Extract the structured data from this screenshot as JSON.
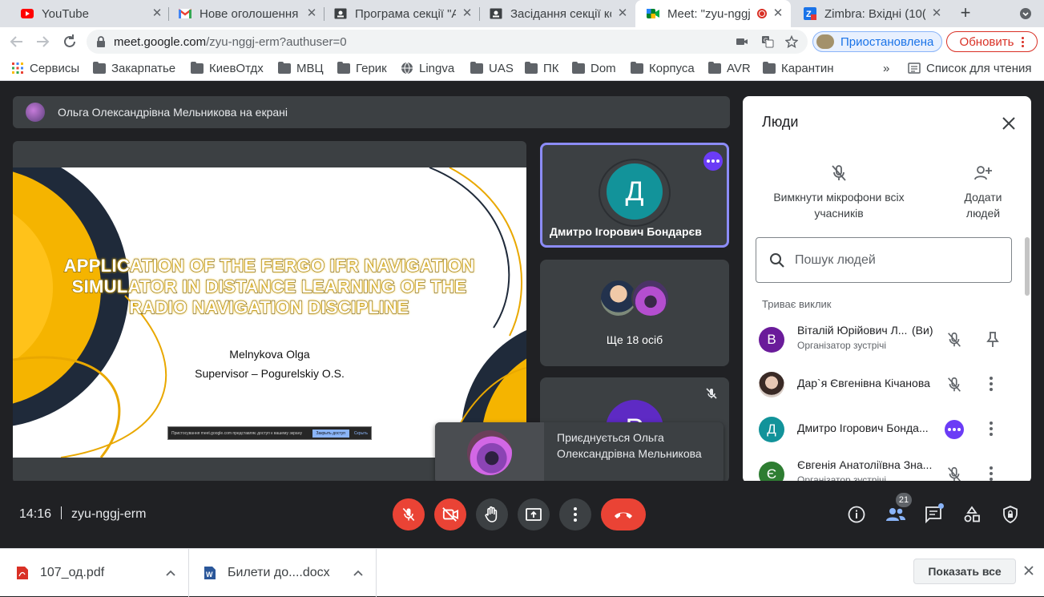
{
  "browser": {
    "tabs": [
      {
        "title": "YouTube",
        "icon": "youtube-icon"
      },
      {
        "title": "Нове оголошення",
        "icon": "gmail-icon"
      },
      {
        "title": "Програма секції \"А",
        "icon": "document-icon"
      },
      {
        "title": "Засідання секції ко",
        "icon": "document-icon"
      },
      {
        "title": "Meet: \"zyu-nggj",
        "icon": "meet-icon",
        "active": true
      },
      {
        "title": "Zimbra: Вхідні (10(",
        "icon": "zimbra-icon"
      }
    ],
    "url_host": "meet.google.com",
    "url_path": "/zyu-nggj-erm?authuser=0",
    "profile_label": "Приостановлена",
    "update_label": "Обновить",
    "bookmarks": [
      {
        "label": "Сервисы",
        "icon": "apps-grid-icon"
      },
      {
        "label": "Закарпатье",
        "icon": "folder-icon"
      },
      {
        "label": "КиевОтдх",
        "icon": "folder-icon"
      },
      {
        "label": "МВЦ",
        "icon": "folder-icon"
      },
      {
        "label": "Герик",
        "icon": "folder-icon"
      },
      {
        "label": "Lingva",
        "icon": "globe-icon"
      },
      {
        "label": "UAS",
        "icon": "folder-icon"
      },
      {
        "label": "ПК",
        "icon": "folder-icon"
      },
      {
        "label": "Dom",
        "icon": "folder-icon"
      },
      {
        "label": "Корпуса",
        "icon": "folder-icon"
      },
      {
        "label": "AVR",
        "icon": "folder-icon"
      },
      {
        "label": "Карантин",
        "icon": "folder-icon"
      }
    ],
    "bookmarks_more": "»",
    "reading_list": "Список для чтения"
  },
  "meet": {
    "presenting_banner": "Ольга Олександрівна Мельникова на екрані",
    "slide": {
      "title": "APPLICATION OF THE FERGO IFR NAVIGATION SIMULATOR IN DISTANCE LEARNING OF THE RADIO NAVIGATION DISCIPLINE",
      "author": "Melnykova Olga",
      "supervisor": "Supervisor – Pogurelskiy O.S.",
      "share_bar_text": "Пристосування meet.google.com представляє доступ к вашему экрану",
      "share_bar_stop": "Закрыть доступ",
      "share_bar_hide": "Скрыть"
    },
    "tiles": {
      "main_initial": "Д",
      "main_name": "Дмитро Ігорович Бондарєв",
      "more_label": "Ще 18 осіб",
      "third_initial": "Р"
    },
    "join_toast": "Приєднується Ольга Олександрівна Мельникова",
    "people": {
      "title": "Люди",
      "mute_all": "Вимкнути мікрофони всіх учасників",
      "add_people": "Додати людей",
      "search_placeholder": "Пошук людей",
      "section": "Триває виклик",
      "participants": [
        {
          "initial": "В",
          "name": "Віталій Юрійович Л...",
          "you": "(Ви)",
          "role": "Організатор зустрічі",
          "color": "#6a1b9a"
        },
        {
          "initial": "",
          "name": "Дар`я Євгенівна Кічанова",
          "role": "",
          "color": "#c9a89a"
        },
        {
          "initial": "Д",
          "name": "Дмитро Ігорович Бонда...",
          "role": "",
          "color": "#12939a"
        },
        {
          "initial": "Є",
          "name": "Євгенія Анатоліївна Зна...",
          "role": "Організатор зустрічі",
          "color": "#2e7d32"
        }
      ]
    },
    "bottom": {
      "time": "14:16",
      "meeting_code": "zyu-nggj-erm",
      "participants_count": "21"
    }
  },
  "downloads": {
    "items": [
      {
        "name": "107_од.pdf",
        "icon": "pdf-file-icon"
      },
      {
        "name": "Билети до....docx",
        "icon": "word-file-icon"
      }
    ],
    "show_all": "Показать все"
  }
}
